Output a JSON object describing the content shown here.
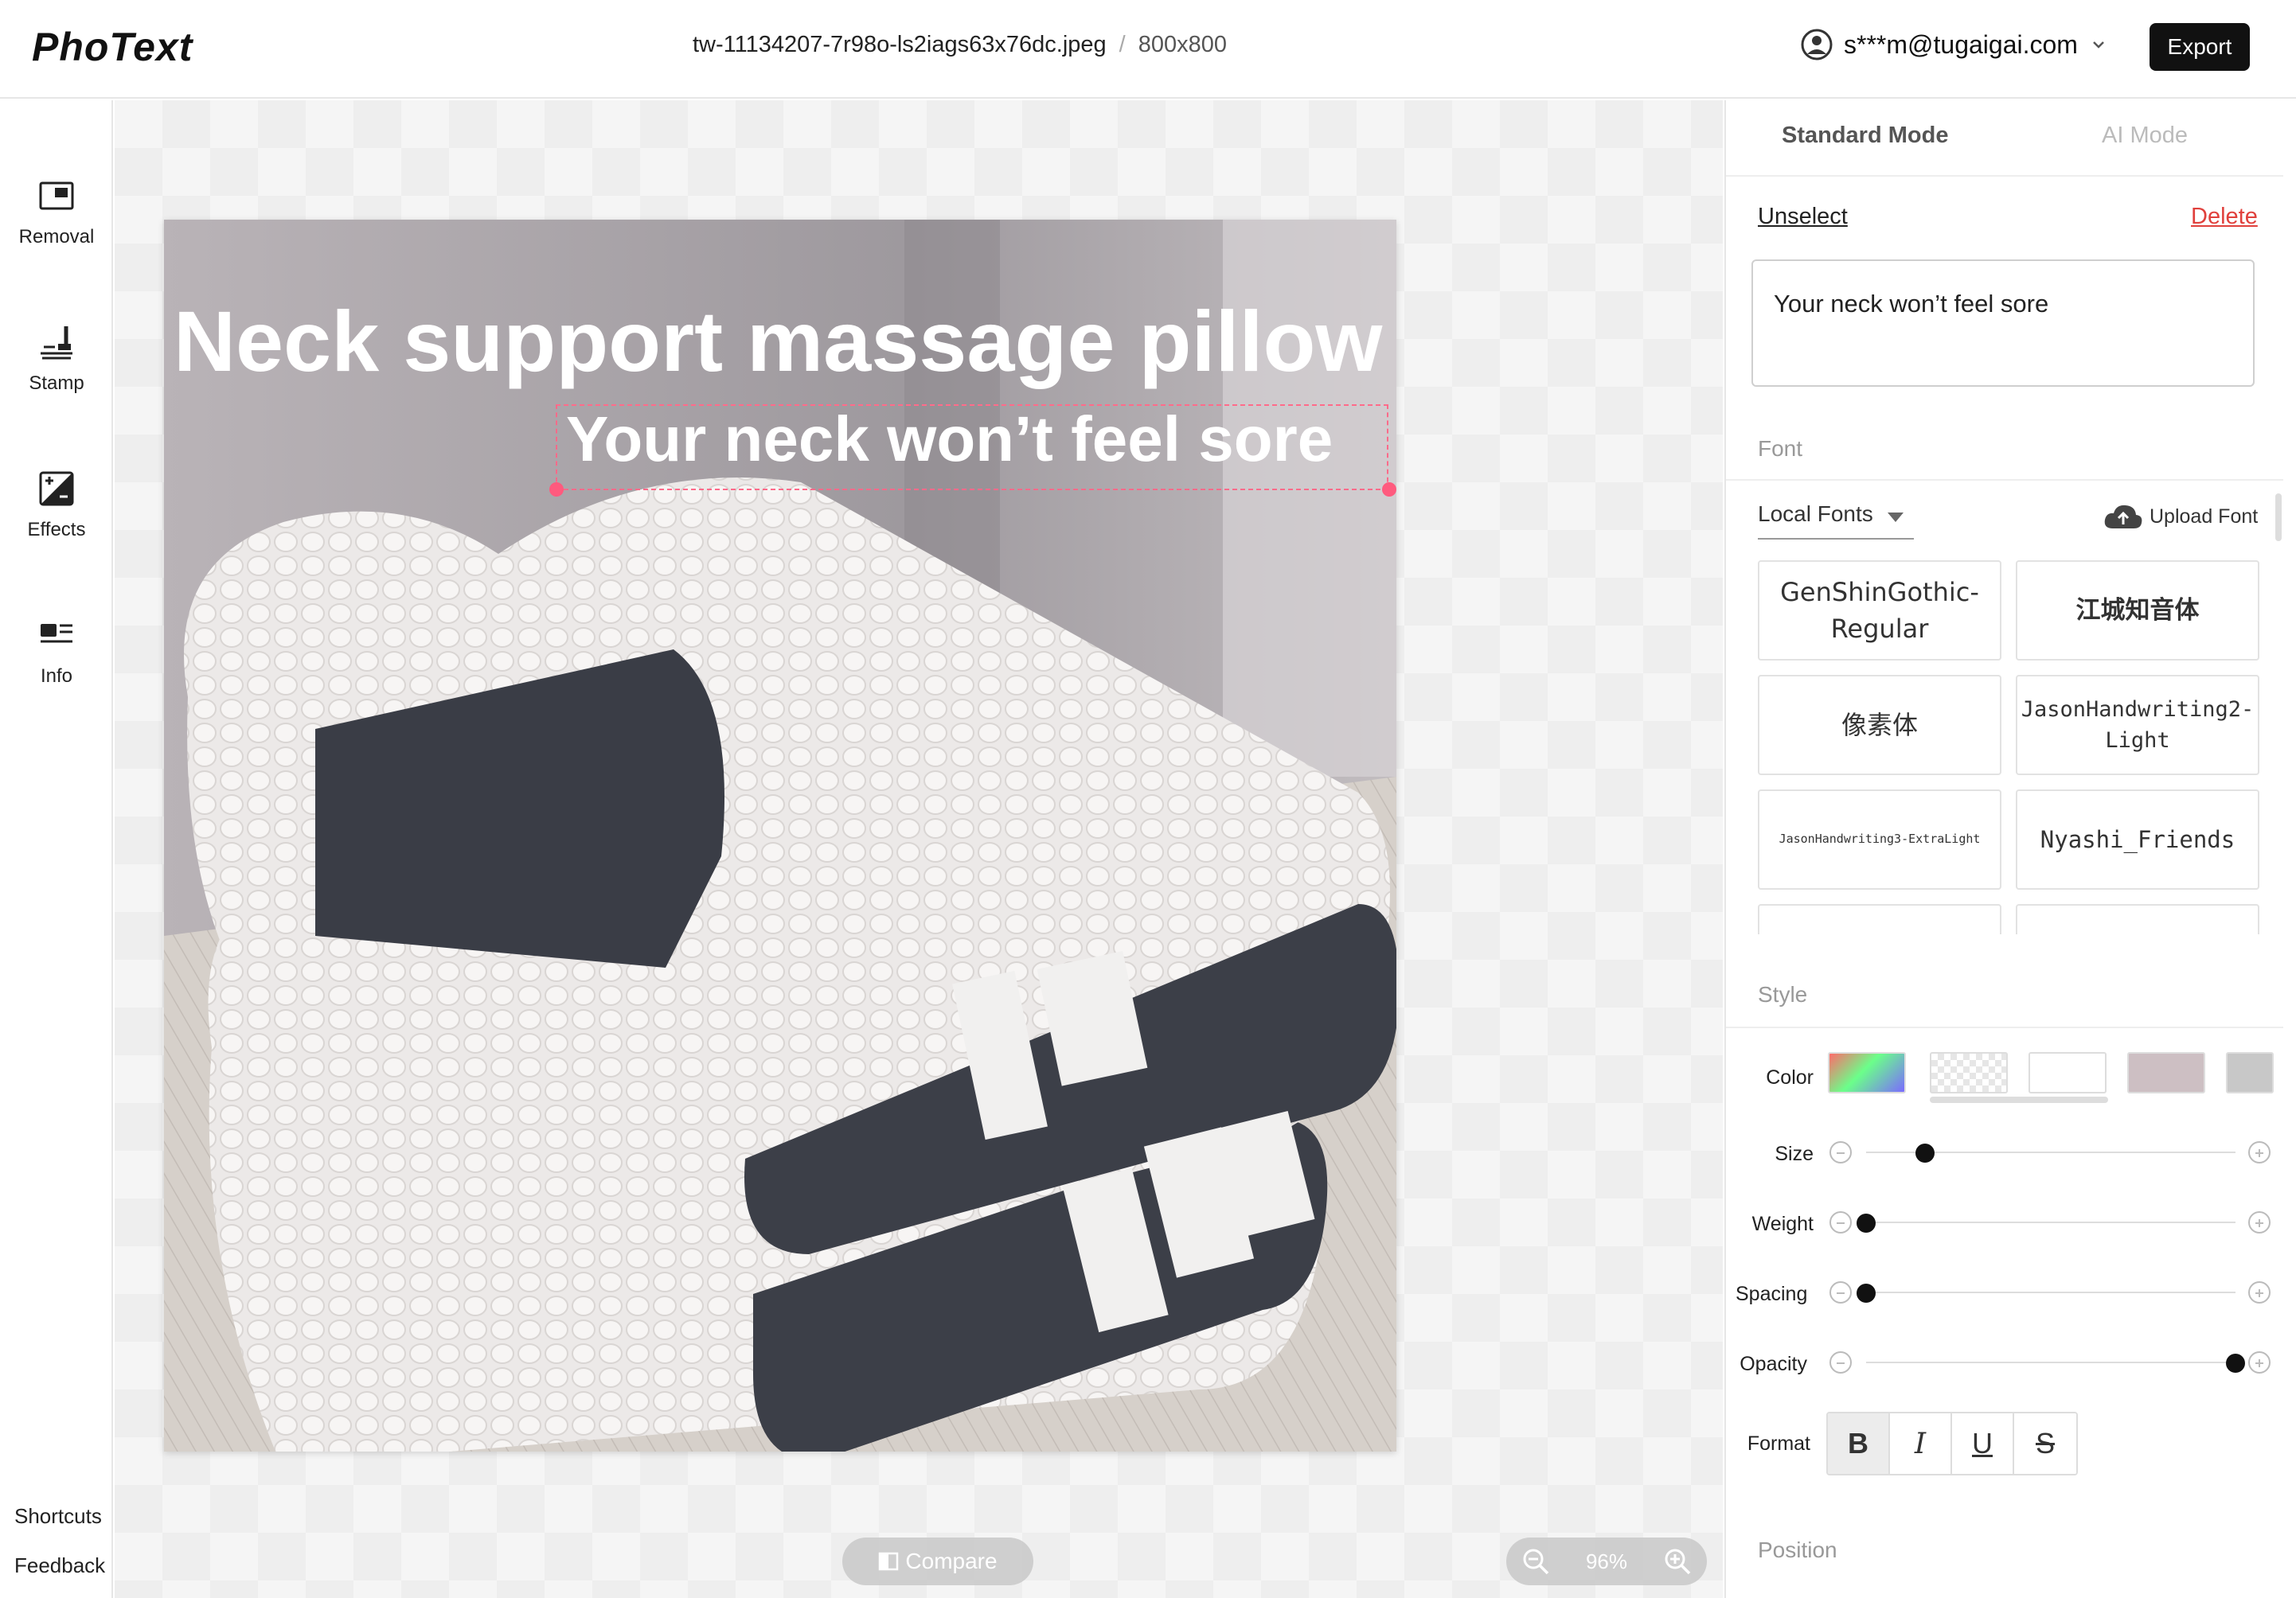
{
  "app": {
    "logo": "PhoText"
  },
  "header": {
    "file_name": "tw-11134207-7r98o-ls2iags63x76dc.jpeg",
    "separator": "/",
    "dimensions": "800x800",
    "user_email": "s***m@tugaigai.com",
    "export_label": "Export"
  },
  "toolbar": {
    "tools": [
      {
        "label": "Removal",
        "icon": "removal-icon"
      },
      {
        "label": "Stamp",
        "icon": "stamp-icon"
      },
      {
        "label": "Effects",
        "icon": "effects-icon"
      },
      {
        "label": "Info",
        "icon": "info-icon"
      }
    ],
    "shortcuts_label": "Shortcuts",
    "feedback_label": "Feedback"
  },
  "canvas": {
    "headline": "Neck support massage pillow",
    "subline": "Your neck won’t feel sore",
    "compare_label": "Compare",
    "zoom_level": "96%"
  },
  "panel": {
    "tabs": {
      "standard": "Standard Mode",
      "ai": "AI Mode"
    },
    "unselect_label": "Unselect",
    "delete_label": "Delete",
    "text_value": "Your neck won’t feel sore",
    "font_section": "Font",
    "font_source": "Local Fonts",
    "upload_font_label": "Upload Font",
    "fonts": [
      "GenShinGothic-Regular",
      "江城知音体",
      "像素体",
      "JasonHandwriting2-Light",
      "JasonHandwriting3-ExtraLight",
      "Nyashi_Friends"
    ],
    "style_section": "Style",
    "labels": {
      "color": "Color",
      "size": "Size",
      "weight": "Weight",
      "spacing": "Spacing",
      "opacity": "Opacity",
      "format": "Format"
    },
    "swatch_colors": [
      "gradient",
      "transparent",
      "#ffffff",
      "#cdbfc3",
      "#c8c8c8"
    ],
    "sliders": {
      "size": 0.16,
      "weight": 0.0,
      "spacing": 0.0,
      "opacity": 1.0
    },
    "format_buttons": [
      "B",
      "I",
      "U",
      "S"
    ],
    "format_active": "B",
    "position_section": "Position"
  },
  "colors": {
    "accent_red": "#e0403c",
    "selection_pink": "#ff5a7e",
    "dark_button": "#111111"
  }
}
